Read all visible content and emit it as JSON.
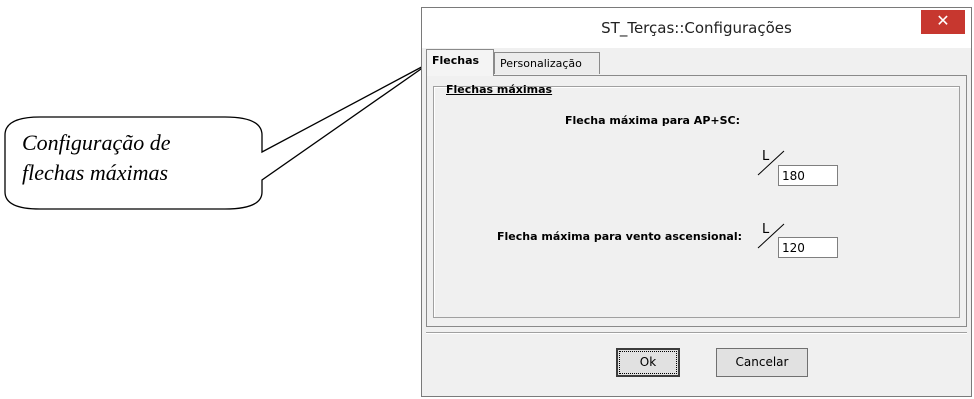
{
  "callout": {
    "line1": "Configuração de",
    "line2": "flechas máximas"
  },
  "window": {
    "title": "ST_Terças::Configurações",
    "close_symbol": "✕"
  },
  "tabs": [
    {
      "label": "Flechas",
      "active": true
    },
    {
      "label": "Personalização",
      "active": false
    }
  ],
  "panel": {
    "section_title": "Flechas máximas",
    "fields": [
      {
        "label": "Flecha máxima para AP+SC:",
        "symbol": "L",
        "value": "180"
      },
      {
        "label": "Flecha máxima para vento ascensional:",
        "symbol": "L",
        "value": "120"
      }
    ]
  },
  "buttons": {
    "ok": "Ok",
    "cancel": "Cancelar"
  }
}
